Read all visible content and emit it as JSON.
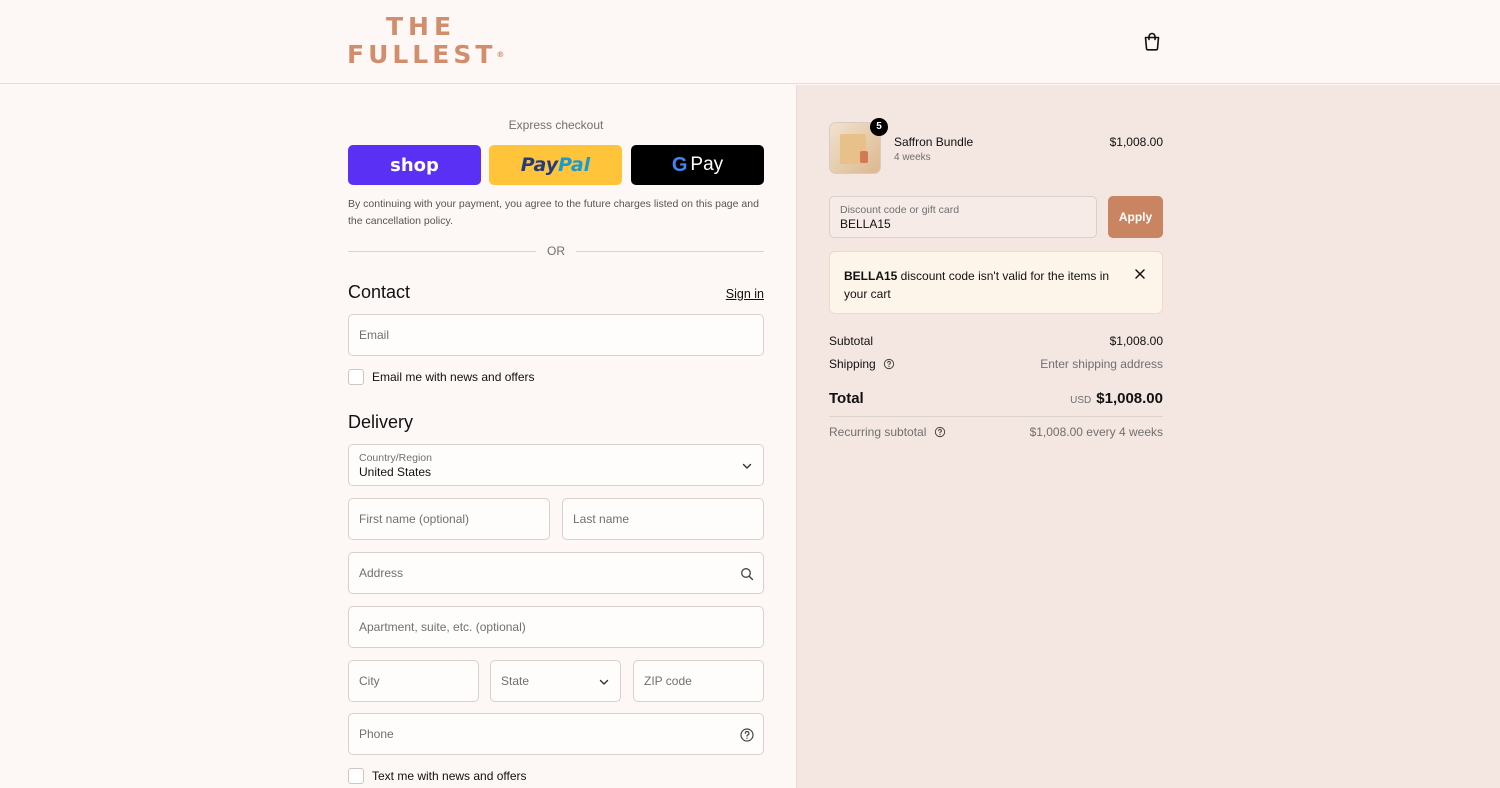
{
  "header": {
    "logo_line1": "THE",
    "logo_line2": "FULLEST",
    "logo_mark": "®",
    "cart_icon": "shopping-bag-icon"
  },
  "express": {
    "title": "Express checkout",
    "shop_label": "shop",
    "paypal_label_1": "Pay",
    "paypal_label_2": "Pal",
    "gpay_g": "G",
    "gpay_label": "Pay",
    "disclaimer": "By continuing with your payment, you agree to the future charges listed on this page and the cancellation policy.",
    "or_label": "OR",
    "colors": {
      "shop": "#5a31f4",
      "paypal": "#ffc439",
      "gpay": "#000000"
    }
  },
  "contact": {
    "title": "Contact",
    "sign_in": "Sign in",
    "email_placeholder": "Email",
    "email_offers": "Email me with news and offers"
  },
  "delivery": {
    "title": "Delivery",
    "country_label": "Country/Region",
    "country_value": "United States",
    "first_name_placeholder": "First name (optional)",
    "last_name_placeholder": "Last name",
    "address_placeholder": "Address",
    "apartment_placeholder": "Apartment, suite, etc. (optional)",
    "city_placeholder": "City",
    "state_placeholder": "State",
    "zip_placeholder": "ZIP code",
    "phone_placeholder": "Phone",
    "text_offers": "Text me with news and offers"
  },
  "order": {
    "product_name": "Saffron Bundle",
    "product_sub": "4 weeks",
    "product_price": "$1,008.00",
    "quantity": "5",
    "discount_label": "Discount code or gift card",
    "discount_value": "BELLA15",
    "apply_label": "Apply",
    "alert_code": "BELLA15",
    "alert_text": " discount code isn't valid for the items in your cart",
    "subtotal_label": "Subtotal",
    "subtotal_value": "$1,008.00",
    "shipping_label": "Shipping",
    "shipping_value": "Enter shipping address",
    "total_label": "Total",
    "total_currency": "USD",
    "total_value": "$1,008.00",
    "recurring_label": "Recurring subtotal",
    "recurring_value": "$1,008.00 every 4 weeks"
  },
  "colors": {
    "accent": "#c98561",
    "logo": "#d18e6c",
    "summary_bg": "#f4e6e0",
    "alert_bg": "#fef5ea"
  }
}
